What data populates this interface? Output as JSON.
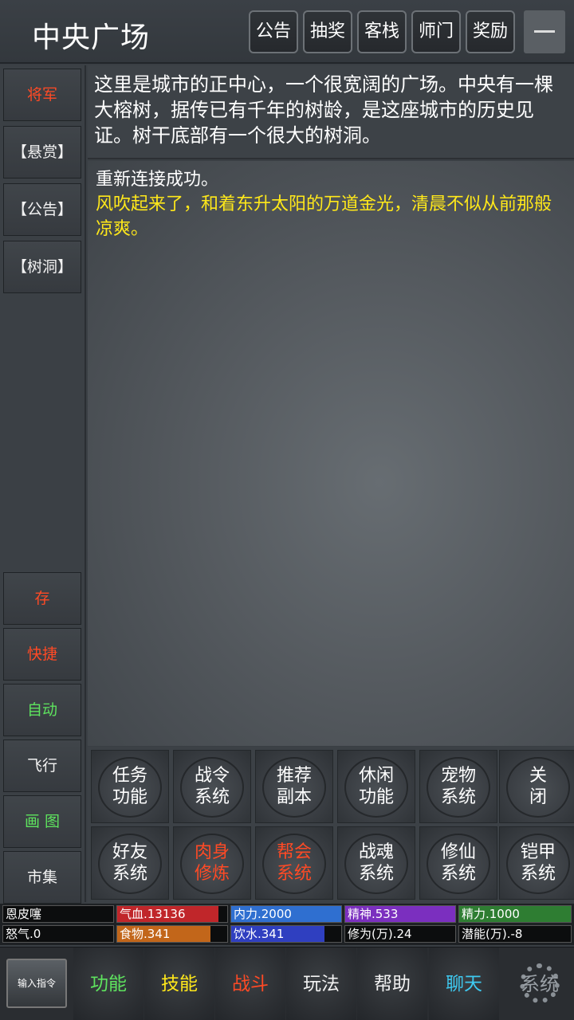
{
  "header": {
    "title": "中央广场",
    "buttons": [
      "公告",
      "抽奖",
      "客栈",
      "师门",
      "奖励"
    ]
  },
  "sidebar": {
    "top": [
      "将军",
      "【悬赏】",
      "【公告】",
      "【树洞】"
    ],
    "bottom": [
      "存",
      "快捷",
      "自动",
      "飞行",
      "画 图",
      "市集"
    ]
  },
  "room_description": "这里是城市的正中心，一个很宽阔的广场。中央有一棵大榕树，据传已有千年的树龄，是这座城市的历史见证。树干底部有一个很大的树洞。",
  "log": {
    "line1": "重新连接成功。",
    "line2": "风吹起来了，和着东升太阳的万道金光，清晨不似从前那般凉爽。"
  },
  "grid": [
    [
      [
        "任务",
        "功能"
      ],
      [
        "战令",
        "系统"
      ],
      [
        "推荐",
        "副本"
      ],
      [
        "休闲",
        "功能"
      ],
      [
        "宠物",
        "系统"
      ],
      [
        "关",
        "闭"
      ]
    ],
    [
      [
        "好友",
        "系统"
      ],
      [
        "肉身",
        "修炼"
      ],
      [
        "帮会",
        "系统"
      ],
      [
        "战魂",
        "系统"
      ],
      [
        "修仙",
        "系统"
      ],
      [
        "铠甲",
        "系统"
      ]
    ]
  ],
  "stats": {
    "name": "恩皮噻",
    "hp": "气血.13136",
    "neili": "内力.2000",
    "jingshen": "精神.533",
    "jingli": "精力.1000",
    "rage": "怒气.0",
    "food": "食物.341",
    "water": "饮水.341",
    "xiuwei": "修为(万).24",
    "qianneng": "潜能(万).-8",
    "colors": {
      "hp": "#c0262a",
      "neili": "#2f6fd0",
      "jingshen": "#7b2fbf",
      "jingli": "#2e7d32",
      "food": "#c2661a",
      "water": "#2f3fc0"
    },
    "fill": {
      "hp": 0.92,
      "neili": 1.0,
      "jingshen": 1.0,
      "jingli": 1.0,
      "food": 0.85,
      "water": 0.85
    }
  },
  "bottom_nav": {
    "input_label": "输入指令",
    "items": [
      "功能",
      "技能",
      "战斗",
      "玩法",
      "帮助",
      "聊天"
    ],
    "system_label": "系统"
  }
}
